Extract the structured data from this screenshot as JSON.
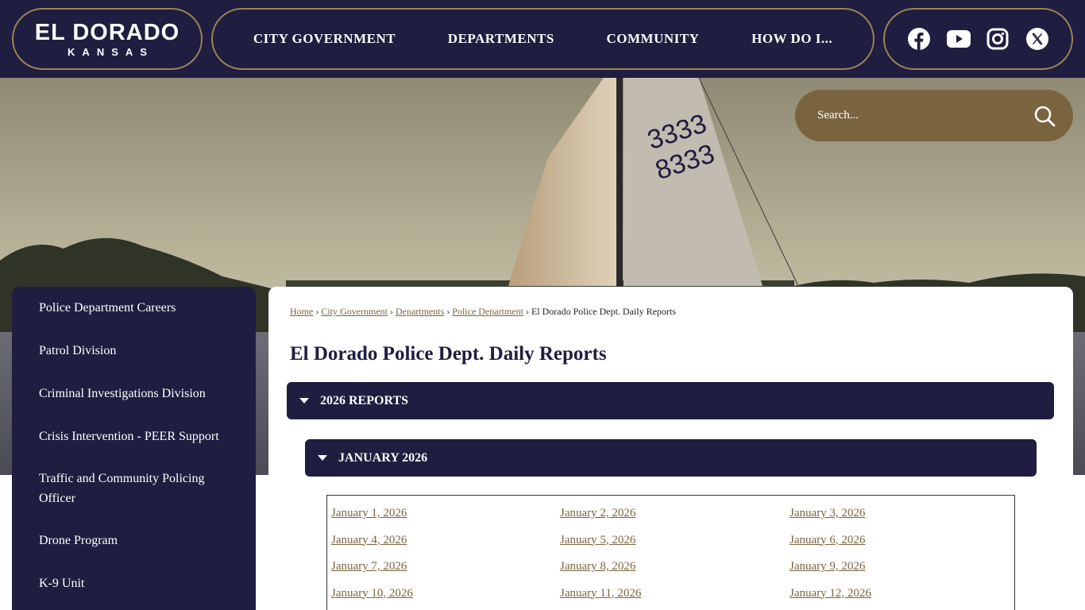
{
  "header": {
    "logo": {
      "main": "EL DORADO",
      "sub": "KANSAS"
    },
    "nav": [
      "CITY GOVERNMENT",
      "DEPARTMENTS",
      "COMMUNITY",
      "HOW DO I..."
    ],
    "social": [
      "facebook-icon",
      "youtube-icon",
      "instagram-icon",
      "x-icon"
    ]
  },
  "search": {
    "placeholder": "Search..."
  },
  "sidebar": {
    "items": [
      {
        "label": "Police Department Careers"
      },
      {
        "label": "Patrol Division"
      },
      {
        "label": "Criminal Investigations Division"
      },
      {
        "label": "Crisis Intervention - PEER Support"
      },
      {
        "label": "Traffic and Community Policing Officer"
      },
      {
        "label": "Drone Program"
      },
      {
        "label": "K-9 Unit"
      }
    ]
  },
  "breadcrumb": {
    "links": [
      "Home",
      "City Government",
      "Departments",
      "Police Department"
    ],
    "current": "El Dorado Police Dept. Daily Reports"
  },
  "page_title": "El Dorado Police Dept. Daily Reports",
  "accordion": {
    "year_label": "2026 REPORTS",
    "month_label": "JANUARY 2026"
  },
  "reports": [
    "January 1, 2026",
    "January 2, 2026",
    "January 3, 2026",
    "January 4, 2026",
    "January 5, 2026",
    "January 6, 2026",
    "January 7, 2026",
    "January 8, 2026",
    "January 9, 2026",
    "January 10, 2026",
    "January 11, 2026",
    "January 12, 2026"
  ],
  "colors": {
    "navy": "#1f1d40",
    "gold": "#9c8455",
    "search_bg": "#7a6440",
    "link": "#7a6440"
  }
}
